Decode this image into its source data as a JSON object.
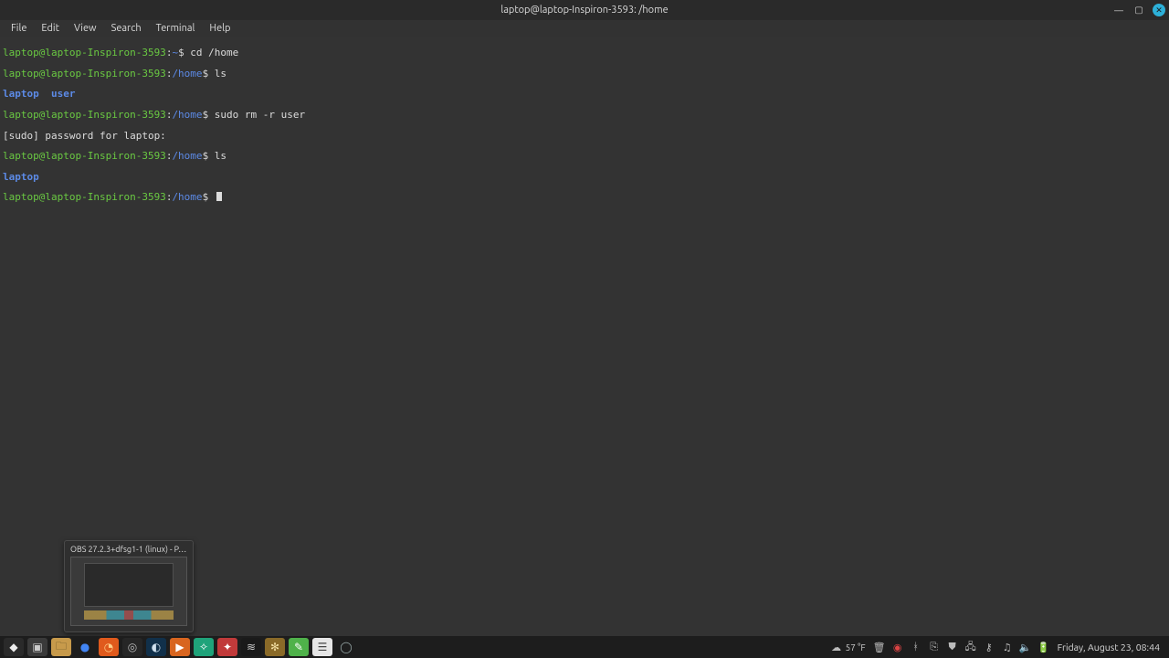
{
  "window": {
    "title": "laptop@laptop-Inspiron-3593: /home"
  },
  "menu": {
    "items": [
      "File",
      "Edit",
      "View",
      "Search",
      "Terminal",
      "Help"
    ]
  },
  "prompt": {
    "user_host": "laptop@laptop-Inspiron-3593",
    "sep": ":",
    "dollar": "$"
  },
  "lines": {
    "l1_path": "~",
    "l1_cmd": " cd /home",
    "l2_path": "/home",
    "l2_cmd": " ls",
    "l3_out": "laptop  user",
    "l4_path": "/home",
    "l4_cmd": " sudo rm -r user",
    "l5_out": "[sudo] password for laptop:",
    "l6_path": "/home",
    "l6_cmd": " ls",
    "l7_out": "laptop",
    "l8_path": "/home",
    "l8_cmd": " "
  },
  "thumbnail": {
    "title": "OBS 27.2.3+dfsg1-1 (linux) - P…"
  },
  "launchers": [
    {
      "name": "mint-menu",
      "bg": "#2a2a2a",
      "glyph": "◆",
      "fg": "#eee"
    },
    {
      "name": "show-desktop",
      "bg": "#3a3a3a",
      "glyph": "▣",
      "fg": "#ccc"
    },
    {
      "name": "files",
      "bg": "#c79a4b",
      "glyph": "🗀",
      "fg": "#5a4a20"
    },
    {
      "name": "chrome",
      "bg": "transparent",
      "glyph": "●",
      "fg": "#4285F4"
    },
    {
      "name": "firefox",
      "bg": "#e05a1c",
      "glyph": "◔",
      "fg": "#ffd089"
    },
    {
      "name": "obs",
      "bg": "#262626",
      "glyph": "◎",
      "fg": "#bbb"
    },
    {
      "name": "steam",
      "bg": "#11304a",
      "glyph": "◐",
      "fg": "#cfe0ee"
    },
    {
      "name": "media-player",
      "bg": "#d8651f",
      "glyph": "▶",
      "fg": "#fff"
    },
    {
      "name": "app-green",
      "bg": "#1fa37a",
      "glyph": "✧",
      "fg": "#fff"
    },
    {
      "name": "app-red",
      "bg": "#c13a3a",
      "glyph": "✦",
      "fg": "#fff"
    },
    {
      "name": "htop",
      "bg": "#1a1a1a",
      "glyph": "≋",
      "fg": "#ccc"
    },
    {
      "name": "app-gear",
      "bg": "#8a6a28",
      "glyph": "✻",
      "fg": "#f0dca0"
    },
    {
      "name": "app-leaf",
      "bg": "#4fb24a",
      "glyph": "✎",
      "fg": "#fff"
    },
    {
      "name": "notes",
      "bg": "#e6e6e6",
      "glyph": "☰",
      "fg": "#444"
    },
    {
      "name": "mint-logo",
      "bg": "transparent",
      "glyph": "◯",
      "fg": "#9aa"
    }
  ],
  "tray": {
    "weather_icon": "☁",
    "weather_temp": "57 °F",
    "icons": [
      {
        "name": "trash-icon",
        "glyph": "🗑"
      },
      {
        "name": "record-icon",
        "glyph": "◉",
        "cls": "red"
      },
      {
        "name": "bluetooth-icon",
        "glyph": "ᚼ"
      },
      {
        "name": "clipboard-icon",
        "glyph": "⎘"
      },
      {
        "name": "update-icon",
        "glyph": "⛊"
      },
      {
        "name": "network-icon",
        "glyph": "🖧"
      },
      {
        "name": "wifi-icon",
        "glyph": "⚷"
      },
      {
        "name": "music-icon",
        "glyph": "♫"
      },
      {
        "name": "volume-icon",
        "glyph": "🔈"
      },
      {
        "name": "battery-icon",
        "glyph": "🔋"
      }
    ],
    "clock": "Friday, August 23, 08:44"
  }
}
